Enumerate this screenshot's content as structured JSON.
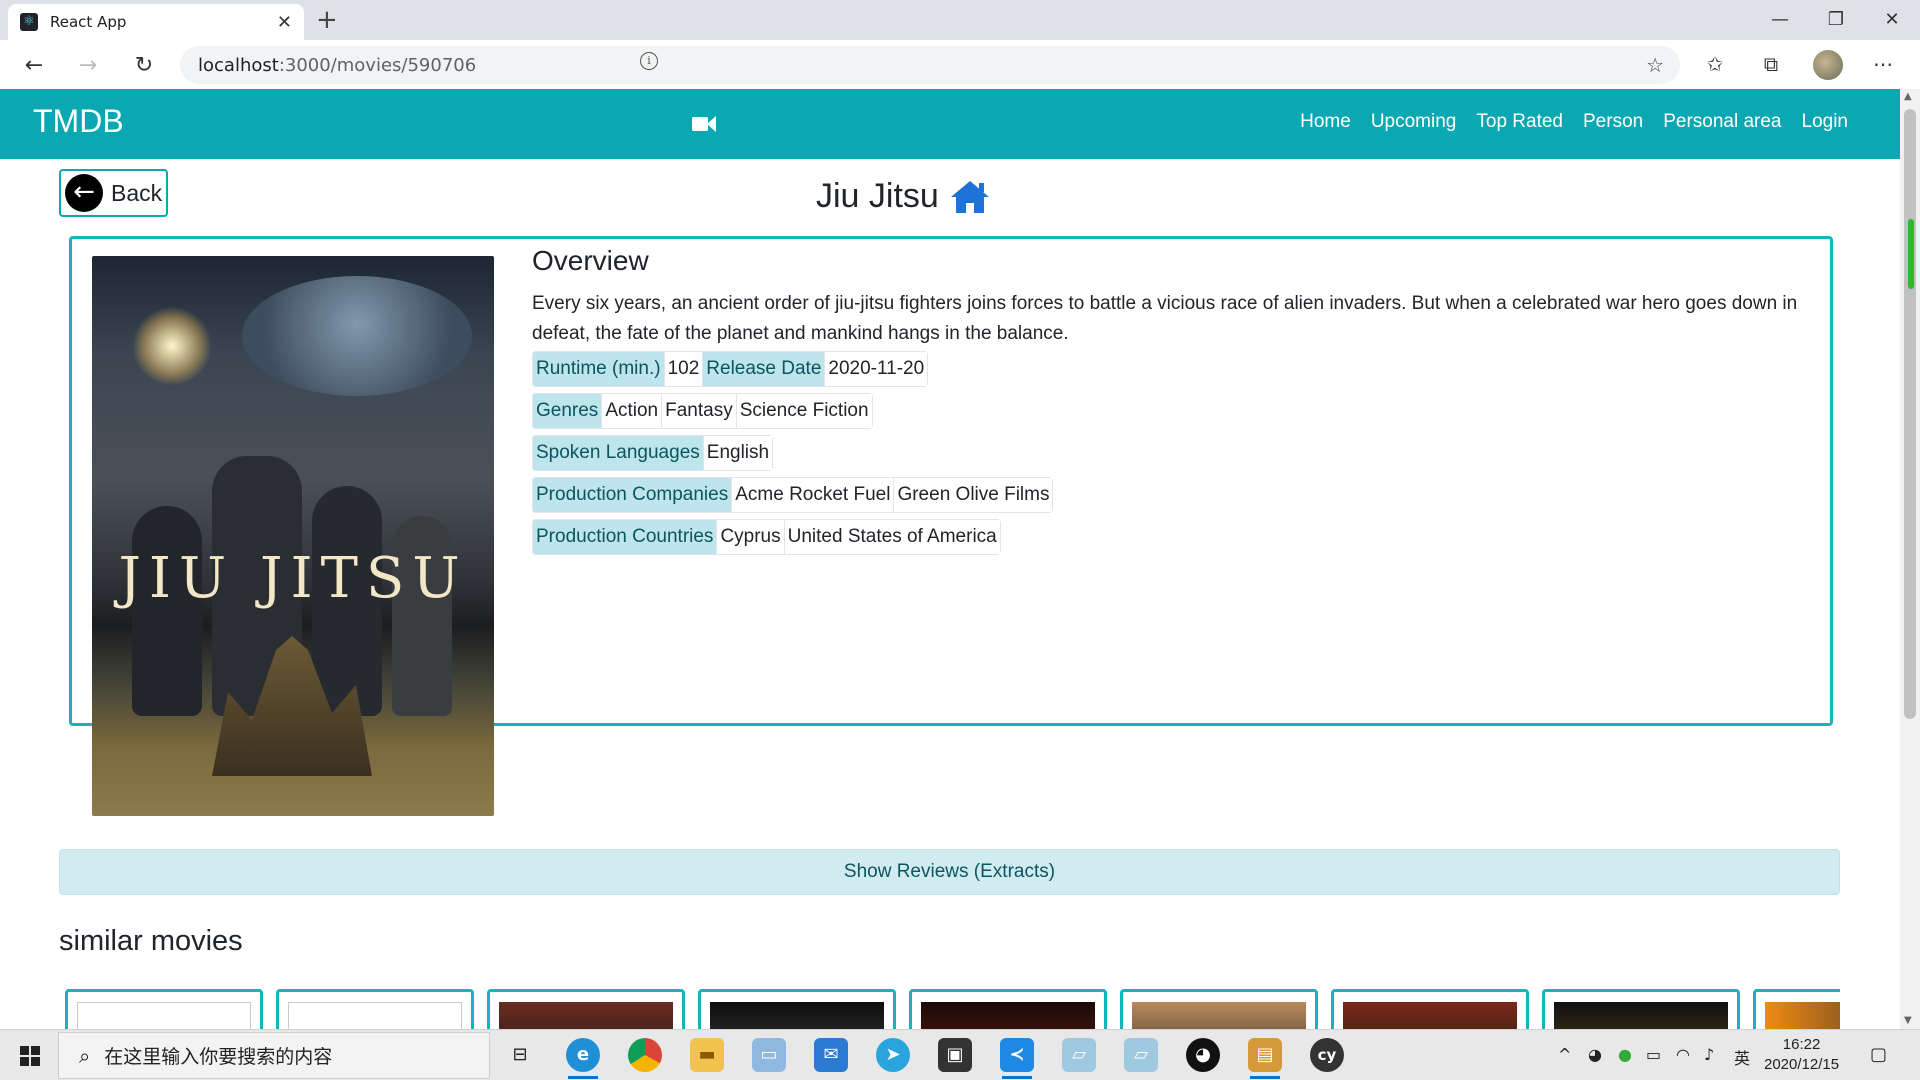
{
  "browser": {
    "tab_title": "React App",
    "tab_close": "✕",
    "new_tab": "+",
    "window": {
      "minimize": "—",
      "restore": "❐",
      "close": "✕"
    },
    "url_host": "localhost",
    "url_path": ":3000/movies/590706"
  },
  "navbar": {
    "brand": "TMDB",
    "links": [
      "Home",
      "Upcoming",
      "Top Rated",
      "Person",
      "Personal area",
      "Login"
    ]
  },
  "page": {
    "back_label": "Back",
    "movie_title": "Jiu Jitsu",
    "overview_heading": "Overview",
    "overview_text": "Every six years, an ancient order of jiu-jitsu fighters joins forces to battle a vicious race of alien invaders. But when a celebrated war hero goes down in defeat, the fate of the planet and mankind hangs in the balance.",
    "poster_title": "JIU JITSU",
    "details": [
      {
        "cells": [
          {
            "text": "Runtime (min.)",
            "head": true
          },
          {
            "text": "102",
            "head": false
          },
          {
            "text": "Release Date",
            "head": true
          },
          {
            "text": "2020-11-20",
            "head": false
          }
        ]
      },
      {
        "cells": [
          {
            "text": "Genres",
            "head": true
          },
          {
            "text": "Action",
            "head": false
          },
          {
            "text": "Fantasy",
            "head": false
          },
          {
            "text": "Science Fiction",
            "head": false
          }
        ]
      },
      {
        "cells": [
          {
            "text": "Spoken Languages",
            "head": true
          },
          {
            "text": "English",
            "head": false
          }
        ]
      },
      {
        "cells": [
          {
            "text": "Production Companies",
            "head": true
          },
          {
            "text": "Acme Rocket Fuel",
            "head": false
          },
          {
            "text": "Green Olive Films",
            "head": false
          }
        ]
      },
      {
        "cells": [
          {
            "text": "Production Countries",
            "head": true
          },
          {
            "text": "Cyprus",
            "head": false
          },
          {
            "text": "United States of America",
            "head": false
          }
        ]
      }
    ],
    "reviews_button": "Show Reviews (Extracts)",
    "similar_heading": "similar movies",
    "similar_thumbs": [
      "broken-image",
      "broken-image",
      "poster",
      "poster",
      "poster",
      "poster",
      "poster",
      "poster",
      "poster"
    ]
  },
  "taskbar": {
    "search_placeholder": "在这里输入你要搜索的内容",
    "ime": "英",
    "time": "16:22",
    "date": "2020/12/15"
  },
  "colors": {
    "accent": "#0aa8b3",
    "chip_head_bg": "#bee5eb",
    "reviews_bg": "#d1ecf1"
  }
}
